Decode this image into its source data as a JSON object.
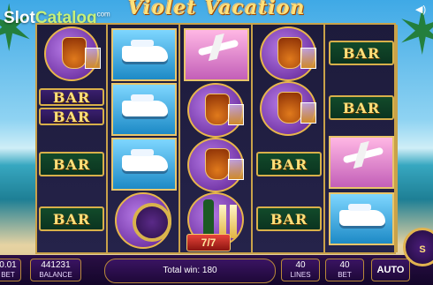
{
  "header": {
    "title": "Violet Vacation",
    "watermark_main": "Slot",
    "watermark_accent": "Catalog",
    "watermark_suffix": "com"
  },
  "reels": [
    [
      "cognac",
      "yacht",
      "bar",
      "bar_double",
      "bar"
    ],
    [
      "yacht",
      "yacht",
      "yacht",
      "watch"
    ],
    [
      "plane",
      "cognac",
      "cognac",
      "champagne"
    ],
    [
      "cognac",
      "cognac",
      "bar",
      "bar"
    ],
    [
      "bar",
      "bar",
      "plane",
      "yacht"
    ]
  ],
  "symbols": {
    "bar_label": "BAR"
  },
  "win_badge": "7/7",
  "bottom_bar": {
    "bet_value": "0.01",
    "bet_label": "BET",
    "balance_value": "441231",
    "balance_label": "BALANCE",
    "total_win": "Total win: 180",
    "lines_value": "40",
    "lines_label": "LINES",
    "bet2_value": "40",
    "bet2_label": "BET",
    "auto_label": "AUTO",
    "spin_label": "S"
  },
  "colors": {
    "gold": "#c9a24a",
    "purple": "#3a1462",
    "bar_green": "#124a2a"
  }
}
